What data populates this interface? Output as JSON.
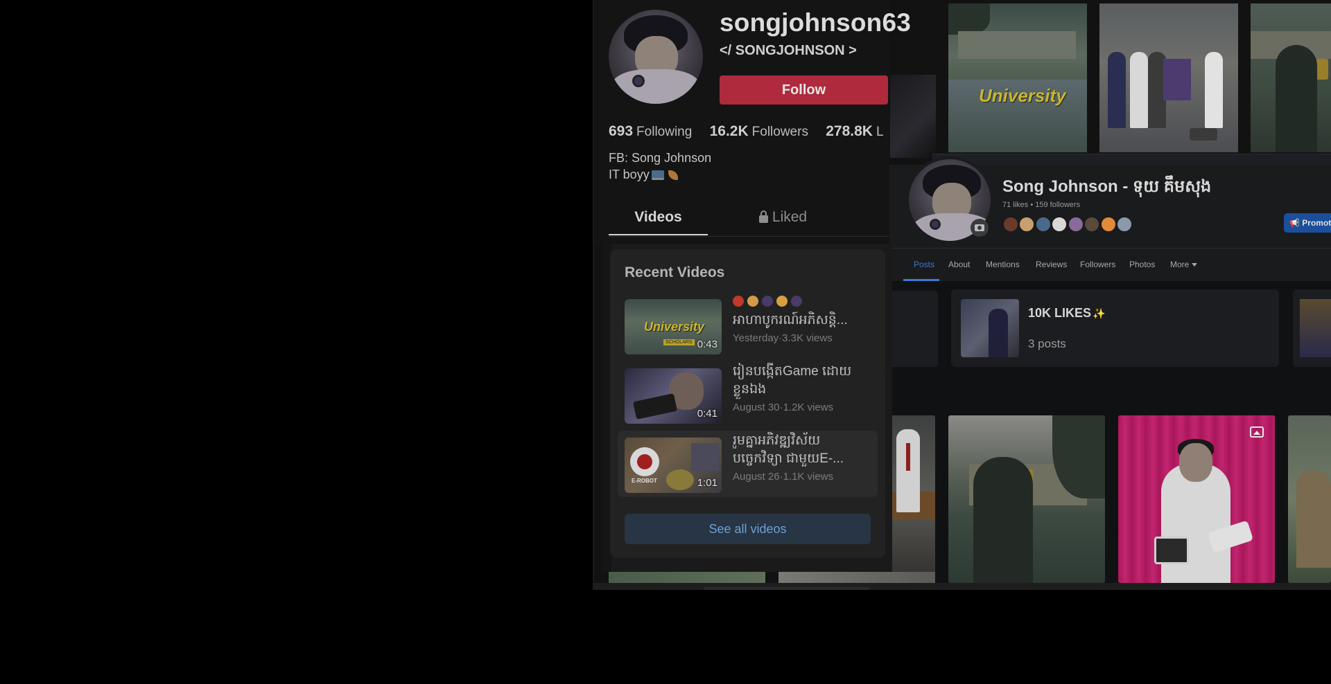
{
  "tiktok": {
    "username": "songjohnson63",
    "nickname": "</ SONGJOHNSON >",
    "follow_label": "Follow",
    "stats": [
      {
        "value": "693",
        "label": "Following"
      },
      {
        "value": "16.2K",
        "label": "Followers"
      },
      {
        "value": "278.8K",
        "label": "L"
      }
    ],
    "bio_line1": "FB: Song Johnson",
    "bio_line2": "IT boyy",
    "tabs": {
      "videos": "Videos",
      "liked": "Liked"
    },
    "grid_caption": "University"
  },
  "recent_videos": {
    "title": "Recent Videos",
    "items": [
      {
        "line1": "",
        "line2": "អាហាបូករណ៍អភិសន្តិ...",
        "duration": "0:43",
        "date": "Yesterday",
        "views": "3.3K views",
        "thumb_text": "University",
        "thumb_sub": "SCHOLARS"
      },
      {
        "line1": "រៀនបង្កើតGame ដោយ",
        "line2": "ខ្លួនឯង",
        "duration": "0:41",
        "date": "August 30",
        "views": "1.2K views"
      },
      {
        "line1": "រួមគ្នាអភិវឌ្ឍវិស័យ",
        "line2": "បច្ចេកវិទ្យា ជាមួយE-...",
        "duration": "1:01",
        "date": "August 26",
        "views": "1.1K views",
        "thumb_text": "E-ROBOT"
      }
    ],
    "see_all_label": "See all videos",
    "meta_separator": "·"
  },
  "facebook": {
    "name": "Song Johnson - ទុយ គឹមសុង",
    "subline": "71 likes • 159 followers",
    "promote_label": "Promote",
    "nav": [
      "Posts",
      "About",
      "Mentions",
      "Reviews",
      "Followers",
      "Photos",
      "More"
    ],
    "card": {
      "title": "10K LIKES",
      "count": "3 posts"
    }
  },
  "colors": {
    "follow": "#b02a3e",
    "fb_accent": "#3f78d6",
    "promote": "#1b4f9c",
    "see_all_text": "#6c9fd4"
  },
  "icons": [
    "laptop-icon",
    "leaf-icon",
    "lock-icon",
    "camera-icon",
    "sparkle-icon",
    "gallery-icon",
    "megaphone-icon",
    "caret-down-icon"
  ]
}
